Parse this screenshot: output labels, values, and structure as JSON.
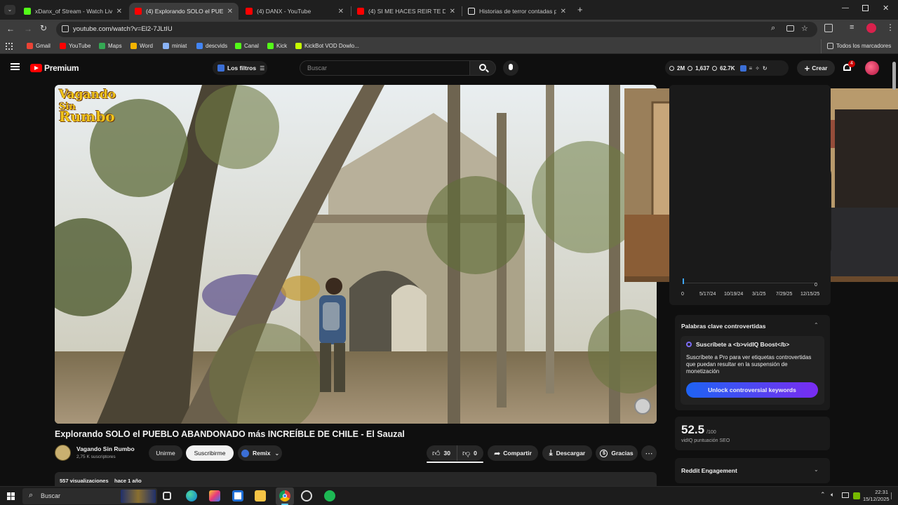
{
  "browser": {
    "tabs": [
      {
        "title": "xDanx_of Stream - Watch Live o",
        "active": false,
        "favicon_color": "#53fc18"
      },
      {
        "title": "(4) Explorando SOLO el PUEBLO",
        "active": true,
        "favicon_color": "#ff0000"
      },
      {
        "title": "(4) DANX - YouTube",
        "active": false,
        "favicon_color": "#ff0000"
      },
      {
        "title": "(4) SI ME HACES REIR TE DOY D",
        "active": false,
        "favicon_color": "#ff0000"
      },
      {
        "title": "Historias de terror contadas po",
        "active": false,
        "favicon_color": "#ffffff"
      }
    ],
    "url": "youtube.com/watch?v=El2-7JLtIU",
    "bookmarks": [
      {
        "label": "Gmail",
        "color": "#ea4335"
      },
      {
        "label": "YouTube",
        "color": "#ff0000"
      },
      {
        "label": "Maps",
        "color": "#34a853"
      },
      {
        "label": "Word",
        "color": "#f4b400"
      },
      {
        "label": "miniat",
        "color": "#8ab4f8"
      },
      {
        "label": "descvids",
        "color": "#4285f4"
      },
      {
        "label": "Canal",
        "color": "#53fc18"
      },
      {
        "label": "Kick",
        "color": "#53fc18"
      },
      {
        "label": "KickBot VOD Dowlo...",
        "color": "#c6ff00"
      }
    ],
    "all_bookmarks": "Todos los marcadores"
  },
  "yt": {
    "brand": "Premium",
    "filters_label": "Los filtros",
    "search_placeholder": "Buscar",
    "stats": [
      "2M",
      "1,637",
      "62.7K"
    ],
    "create_label": "Crear",
    "notif_count": "4"
  },
  "video": {
    "channel_logo_line1": "Vagando",
    "channel_logo_line2": "Sin",
    "channel_logo_line3": "Rumbo",
    "title": "Explorando SOLO el PUEBLO ABANDONADO más INCREÍBLE DE CHILE - El Sauzal",
    "channel": "Vagando Sin Rumbo",
    "subscribers": "2,75 K suscriptores",
    "join_label": "Unirme",
    "subscribe_label": "Suscribirme",
    "remix_label": "Remix",
    "likes": "30",
    "dislikes": "0",
    "share_label": "Compartir",
    "download_label": "Descargar",
    "thanks_label": "Gracias",
    "views": "557 visualizaciones",
    "age": "hace 1 año"
  },
  "sidebar": {
    "chart_ticks_x": [
      "0",
      "5/17/24",
      "10/19/24",
      "3/1/25",
      "7/29/25",
      "12/15/25"
    ],
    "chart_tick_right": "0",
    "controversial_title": "Palabras clave controvertidas",
    "promo_title": "Suscríbete a <b>vidIQ Boost</b>",
    "promo_text": "Suscríbete a Pro para ver etiquetas controvertidas que puedan resultar en la suspensión de monetización",
    "unlock_label": "Unlock controversial keywords",
    "seo_score": "52.5",
    "seo_max": "/100",
    "seo_label": "vidIQ puntuación SEO",
    "reddit_title": "Reddit Engagement"
  },
  "taskbar": {
    "search_label": "Buscar",
    "time": "22:31",
    "date": "15/12/2025"
  }
}
